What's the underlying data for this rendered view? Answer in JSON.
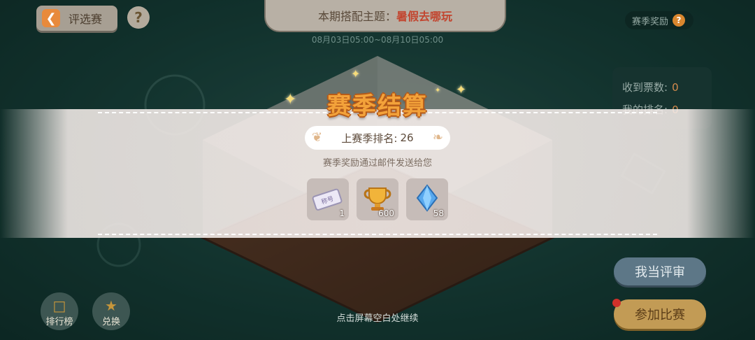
{
  "top_bar": {
    "back_label": "评选赛",
    "help_glyph": "?",
    "theme_prefix": "本期搭配主题：",
    "theme_value": "暑假去哪玩",
    "theme_time": "08月03日05:00~08月10日05:00",
    "season_reward_label": "赛季奖励",
    "season_reward_help": "?"
  },
  "stats": {
    "votes_label": "收到票数:",
    "votes_value": "0",
    "rank_label": "我的排名:",
    "rank_value": "0"
  },
  "bottom": {
    "leaderboard_label": "排行榜",
    "exchange_label": "兑换",
    "judge_label": "我当评审",
    "join_label": "参加比赛",
    "continue_hint": "点击屏幕空白处继续"
  },
  "modal": {
    "title": "赛季结算",
    "rank_label": "上赛季排名:",
    "rank_value": "26",
    "mail_note": "赛季奖励通过邮件发送给您",
    "rewards": [
      {
        "icon": "title-ticket-icon",
        "art_text": "称号",
        "count": "1"
      },
      {
        "icon": "trophy-icon",
        "count": "600"
      },
      {
        "icon": "blue-diamond-icon",
        "count": "58"
      }
    ]
  },
  "colors": {
    "accent_orange": "#f3a23a",
    "theme_red": "#c2452f",
    "background": "#17413b"
  }
}
